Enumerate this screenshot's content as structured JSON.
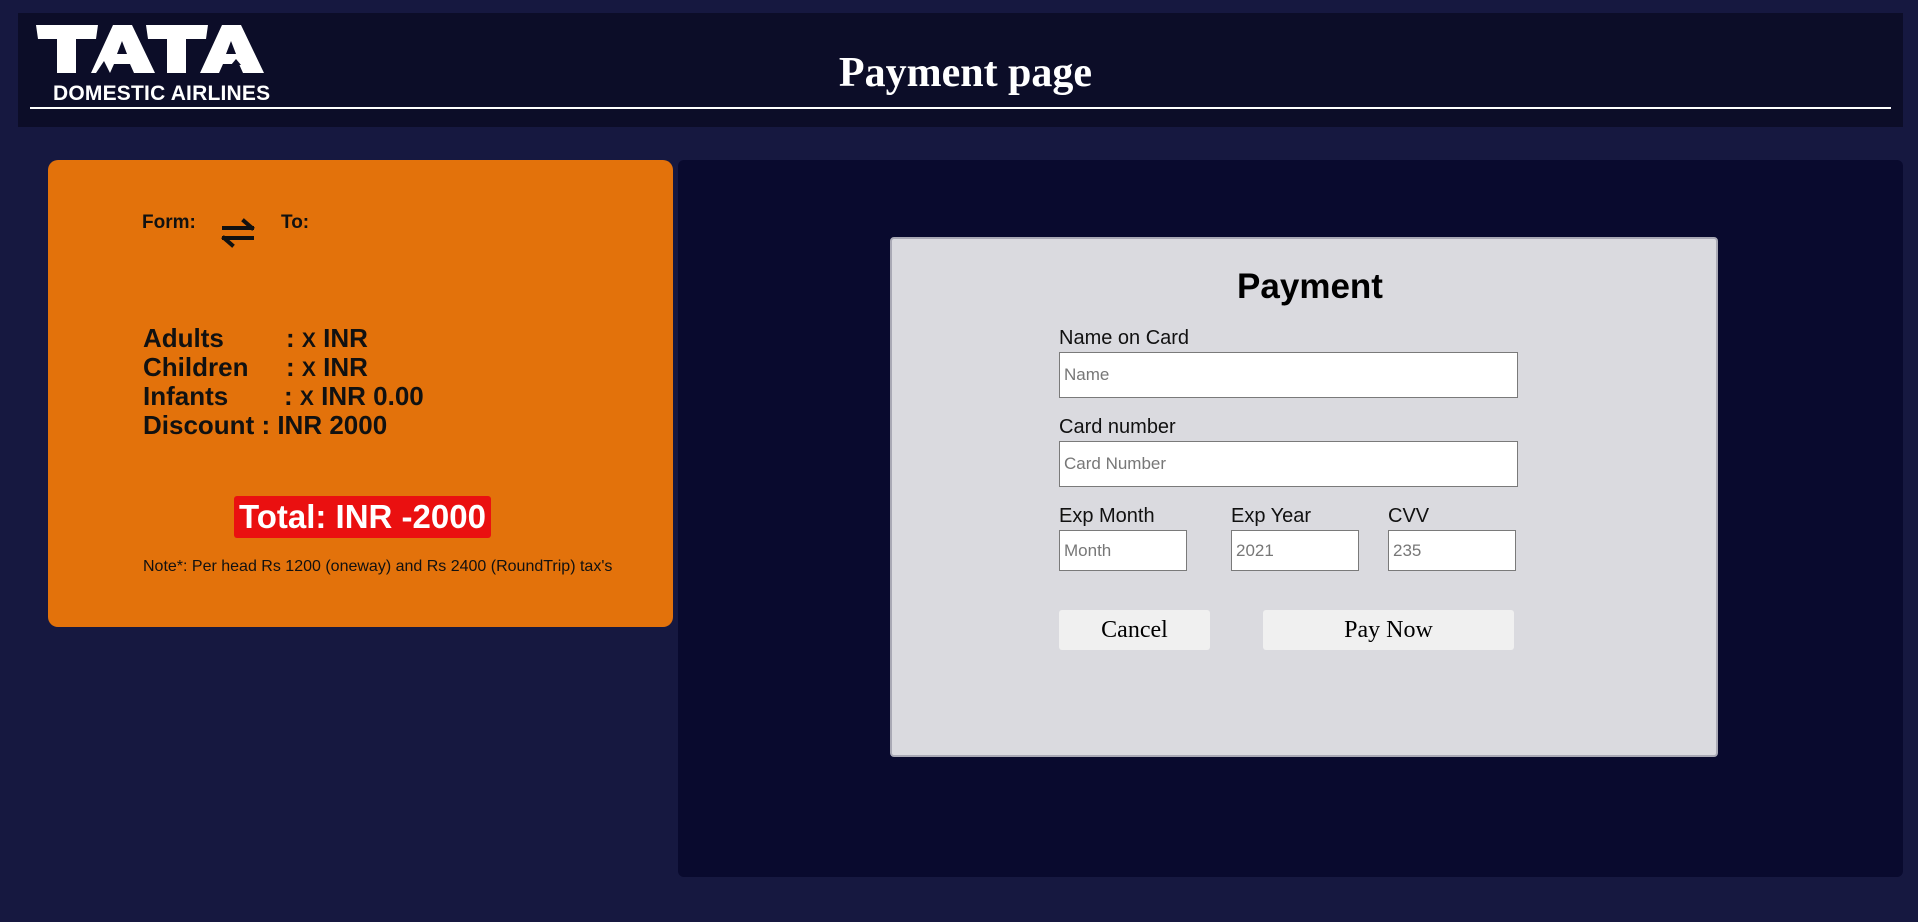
{
  "header": {
    "logo_text": "TATA",
    "logo_subtitle": "DOMESTIC AIRLINES",
    "page_title": "Payment page"
  },
  "summary": {
    "from_label": "Form:",
    "to_label": "To:",
    "rows": [
      {
        "label": "Adults",
        "sep": ":",
        "x": "X",
        "value": "INR"
      },
      {
        "label": "Children",
        "sep": ":",
        "x": "X",
        "value": "INR"
      },
      {
        "label": "Infants",
        "sep": ":",
        "x": "X",
        "value": "INR 0.00"
      }
    ],
    "discount": "Discount : INR 2000",
    "total": "Total: INR -2000",
    "note": "Note*: Per head Rs 1200 (oneway) and Rs 2400 (RoundTrip) tax's"
  },
  "payment": {
    "title": "Payment",
    "name_label": "Name on Card",
    "name_placeholder": "Name",
    "card_label": "Card number",
    "card_placeholder": "Card Number",
    "month_label": "Exp Month",
    "month_placeholder": "Month",
    "year_label": "Exp Year",
    "year_placeholder": "2021",
    "cvv_label": "CVV",
    "cvv_placeholder": "235",
    "cancel_label": "Cancel",
    "pay_label": "Pay Now"
  },
  "colors": {
    "page_bg": "#161840",
    "header_bg": "#0c0d28",
    "summary_bg": "#e3720b",
    "total_bg": "#ea1010",
    "panel_bg": "#090a2e",
    "card_bg": "#dadadf"
  },
  "icons": {
    "logo": "tata-airlines-logo",
    "swap": "swap-arrows-icon"
  }
}
